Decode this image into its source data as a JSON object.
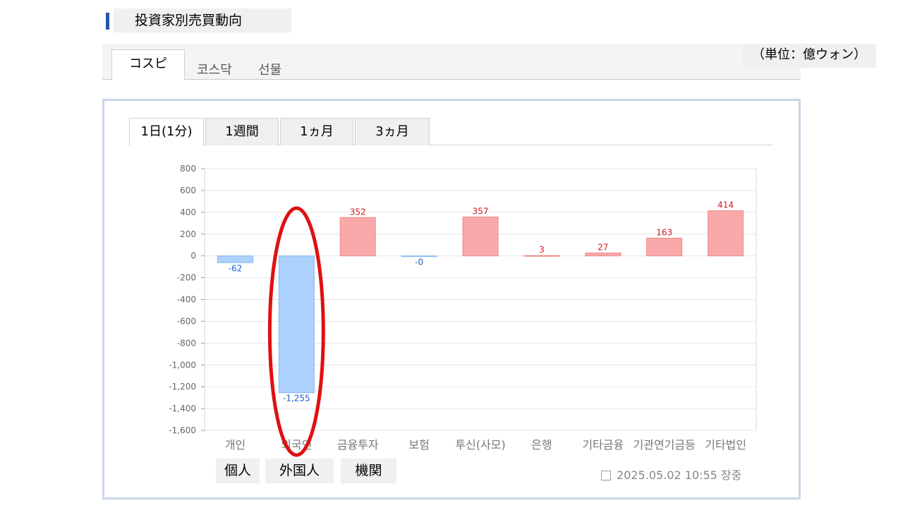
{
  "header": {
    "title": "投資家別売買動向"
  },
  "market_tabs": [
    {
      "label": "コスピ",
      "active": true
    },
    {
      "label": "코스닥",
      "active": false
    },
    {
      "label": "선물",
      "active": false
    }
  ],
  "unit_label": "（単位：億ウォン）",
  "period_tabs": [
    {
      "label": "1日(1分)",
      "active": true
    },
    {
      "label": "1週間",
      "active": false
    },
    {
      "label": "1ヵ月",
      "active": false
    },
    {
      "label": "3ヵ月",
      "active": false
    }
  ],
  "investor_groups": [
    "個人",
    "外国人",
    "機関"
  ],
  "timestamp": "2025.05.02 10:55 장중",
  "colors": {
    "positive": "#f9a9a9",
    "negative": "#acd1fc",
    "positive_text": "#d11a1a",
    "negative_text": "#1f5fd1",
    "highlight": "#e01010"
  },
  "chart_data": {
    "type": "bar",
    "categories": [
      "개인",
      "외국인",
      "금융투자",
      "보험",
      "투신(사모)",
      "은행",
      "기타금융",
      "기관연기금등",
      "기타법인"
    ],
    "values": [
      -62,
      -1255,
      352,
      0,
      357,
      3,
      27,
      163,
      414
    ],
    "value_labels": [
      "-62",
      "-1,255",
      "352",
      "-0",
      "357",
      "3",
      "27",
      "163",
      "414"
    ],
    "ylim": [
      -1600,
      800
    ],
    "yticks": [
      800,
      600,
      400,
      200,
      0,
      -200,
      -400,
      -600,
      -800,
      -1000,
      -1200,
      -1400,
      -1600
    ],
    "ytick_labels": [
      "800",
      "600",
      "400",
      "200",
      "0",
      "-200",
      "-400",
      "-600",
      "-800",
      "-1,000",
      "-1,200",
      "-1,400",
      "-1,600"
    ],
    "grid": true,
    "highlight_category": "외국인"
  }
}
